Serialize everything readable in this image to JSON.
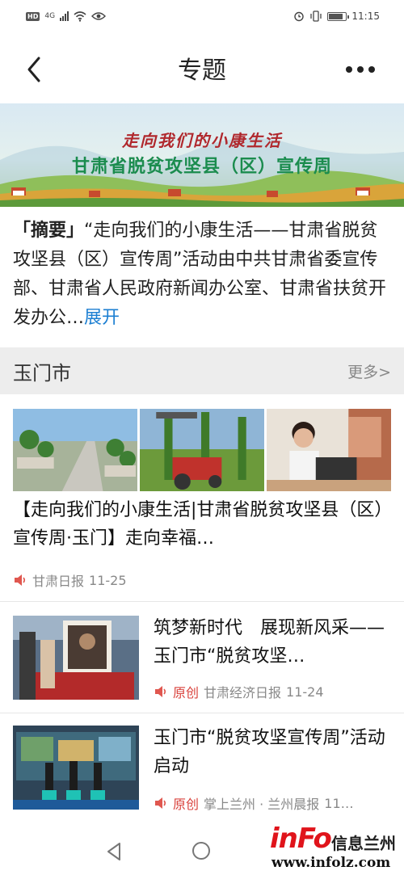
{
  "status_bar": {
    "hd": "HD",
    "signal": "4G",
    "time": "11:15",
    "battery_level": 0.85
  },
  "header": {
    "title": "专题"
  },
  "banner": {
    "line1": "走向我们的小康生活",
    "line2": "甘肃省脱贫攻坚县（区）宣传周"
  },
  "summary": {
    "tag": "「摘要」",
    "text": "“走向我们的小康生活——甘肃省脱贫攻坚县（区）宣传周”活动由中共甘肃省委宣传部、甘肃省人民政府新闻办公室、甘肃省扶贫开发办公…",
    "expand": "展开"
  },
  "section": {
    "title": "玉门市",
    "more": "更多>"
  },
  "articles": [
    {
      "title": "【走向我们的小康生活|甘肃省脱贫攻坚县（区）宣传周·玉门】走向幸福…",
      "source": "甘肃日报",
      "date": "11-25"
    },
    {
      "title": "筑梦新时代　展现新风采——玉门市“脱贫攻坚…",
      "original": "原创",
      "source": "甘肃经济日报",
      "date": "11-24"
    },
    {
      "title": "玉门市“脱贫攻坚宣传周”活动启动",
      "original": "原创",
      "source": "掌上兰州 · 兰州晨报",
      "date": "11…"
    }
  ],
  "watermark": {
    "logo": "inFo",
    "name": "信息兰州",
    "url": "www.infolz.com"
  },
  "colors": {
    "link": "#1c7fd2",
    "original_tag": "#d9423c",
    "section_bg": "#ededed"
  }
}
